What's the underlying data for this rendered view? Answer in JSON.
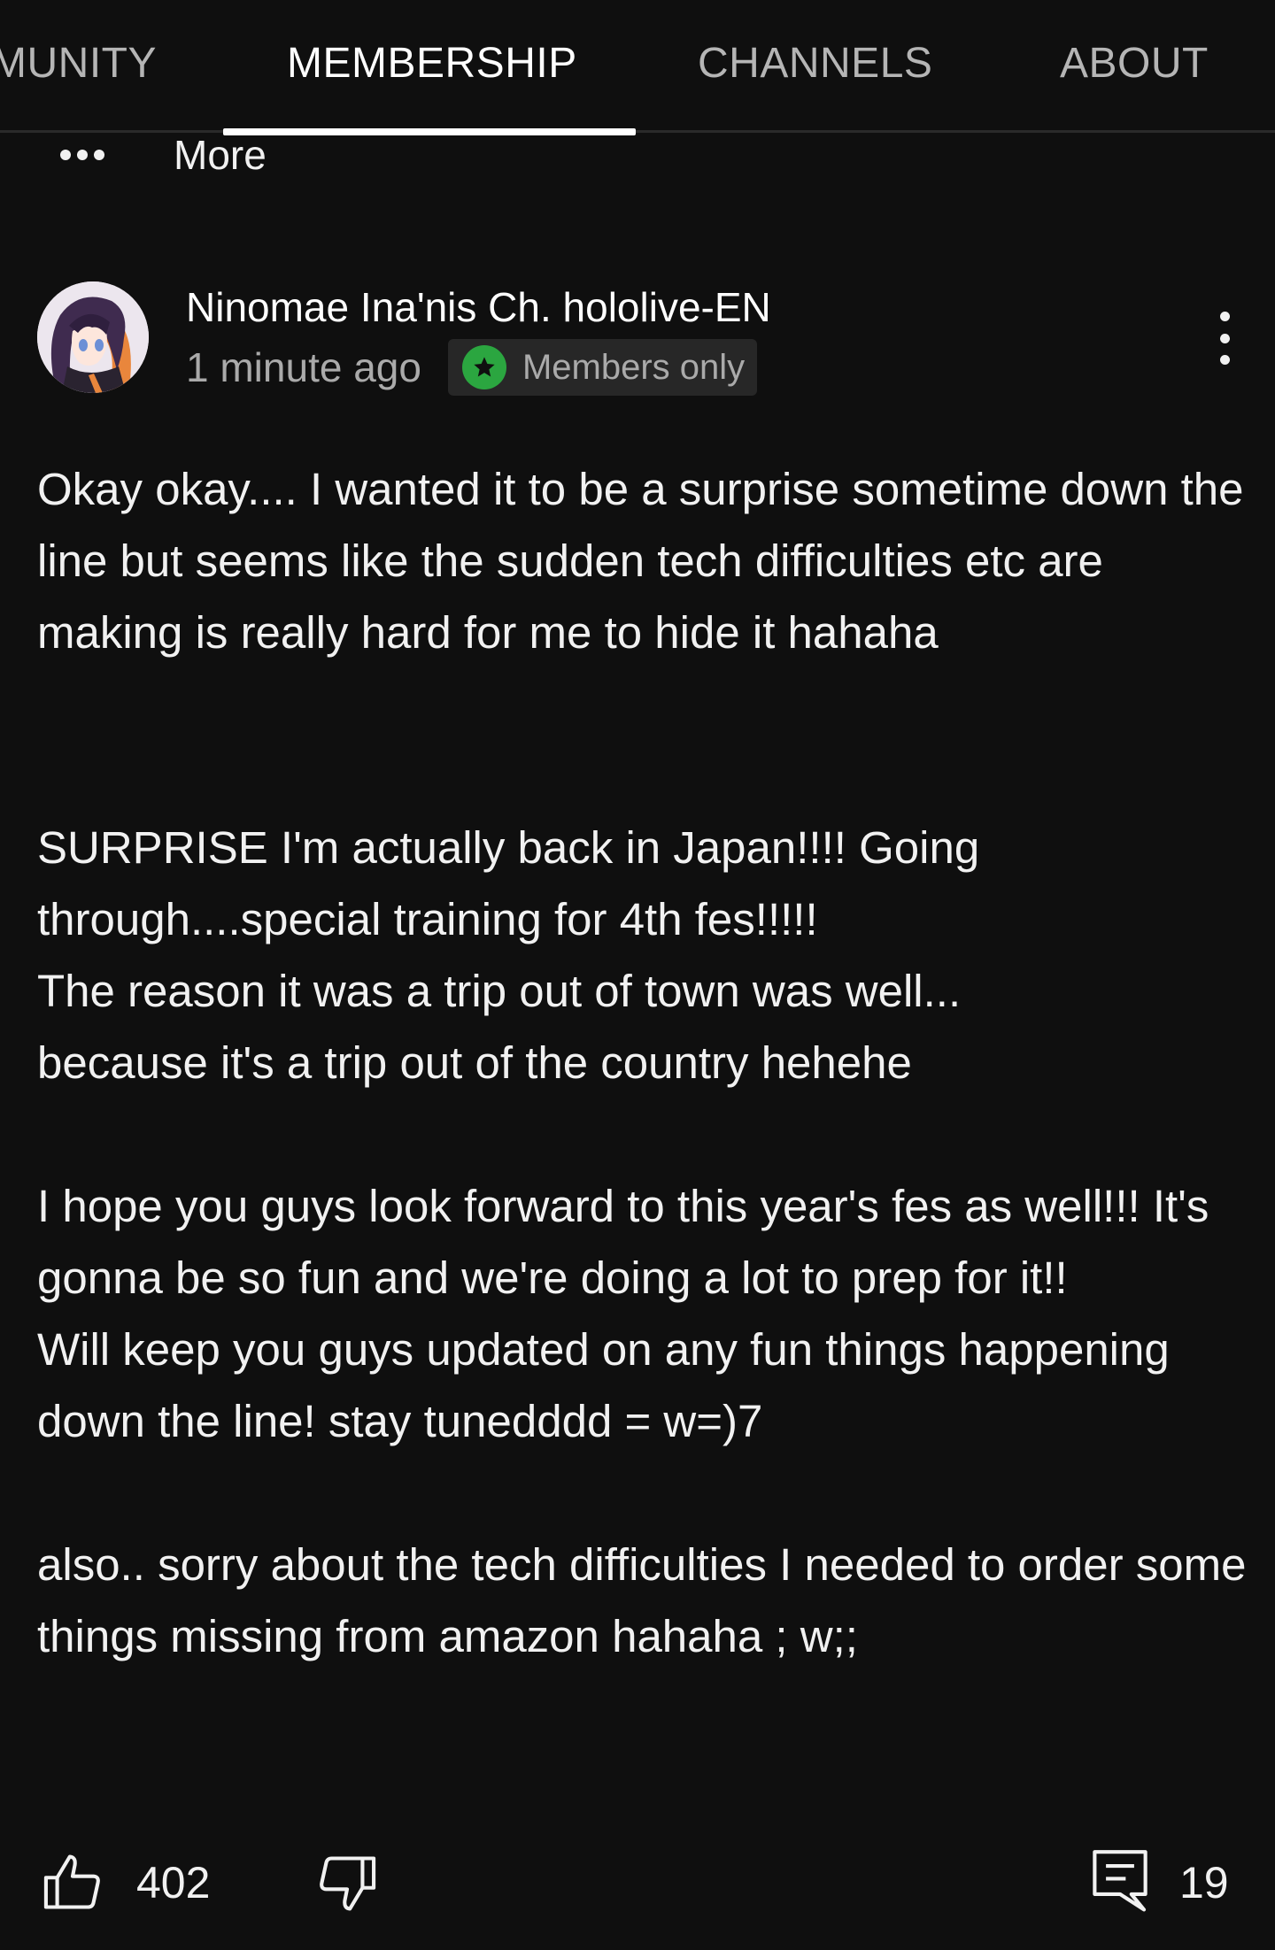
{
  "tabs": [
    {
      "label": "MUNITY",
      "active": false
    },
    {
      "label": "MEMBERSHIP",
      "active": true
    },
    {
      "label": "CHANNELS",
      "active": false
    },
    {
      "label": "ABOUT",
      "active": false
    }
  ],
  "more": {
    "label": "More"
  },
  "post": {
    "author": "Ninomae Ina'nis Ch. hololive-EN",
    "timestamp": "1 minute ago",
    "badge": "Members only",
    "paragraphs": [
      "Okay okay.... I wanted it to be a surprise sometime down the line but seems like the sudden tech difficulties etc are making is really hard for me to hide it hahaha",
      "SURPRISE I'm actually back in Japan!!!! Going through....special training for 4th fes!!!!!\nThe reason it was a trip out of town was well...\nbecause it's a trip out of the country hehehe",
      "I hope you guys look forward to this year's fes as well!!! It's gonna be so fun and we're doing a lot to prep for it!!\nWill keep you guys updated on any fun things happening down the line! stay tunedddd = w=)7",
      "also.. sorry about the tech difficulties I needed to order some things missing from amazon hahaha ; w;;"
    ],
    "likes": "402",
    "comments": "19"
  },
  "colors": {
    "background": "#0f0f0f",
    "text": "#f1f1f1",
    "secondary_text": "#aaaaaa",
    "badge_green": "#2ba640"
  },
  "icons": [
    "more-dots-icon",
    "members-star-icon",
    "kebab-menu-icon",
    "thumbs-up-icon",
    "thumbs-down-icon",
    "comment-icon"
  ]
}
